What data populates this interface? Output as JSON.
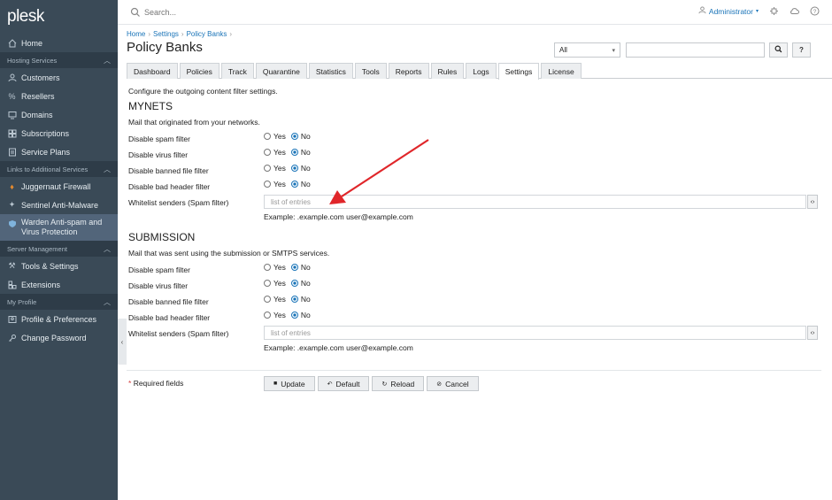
{
  "sidebar": {
    "logo": "plesk",
    "home": "Home",
    "sections": {
      "hosting": "Hosting Services",
      "links": "Links to Additional Services",
      "server": "Server Management",
      "profile": "My Profile"
    },
    "hosting_items": [
      "Customers",
      "Resellers",
      "Domains",
      "Subscriptions",
      "Service Plans"
    ],
    "link_items": [
      "Juggernaut Firewall",
      "Sentinel Anti-Malware",
      "Warden Anti-spam and Virus Protection"
    ],
    "server_items": [
      "Tools & Settings",
      "Extensions"
    ],
    "profile_items": [
      "Profile & Preferences",
      "Change Password"
    ]
  },
  "topbar": {
    "search_placeholder": "Search...",
    "user": "Administrator"
  },
  "breadcrumb": [
    "Home",
    "Settings",
    "Policy Banks"
  ],
  "page_title": "Policy Banks",
  "filter": {
    "select_value": "All"
  },
  "tabs": [
    "Dashboard",
    "Policies",
    "Track",
    "Quarantine",
    "Statistics",
    "Tools",
    "Reports",
    "Rules",
    "Logs",
    "Settings",
    "License"
  ],
  "active_tab": "Settings",
  "intro": "Configure the outgoing content filter settings.",
  "sections": [
    {
      "title": "MYNETS",
      "subtitle": "Mail that originated from your networks.",
      "rows": [
        {
          "label": "Disable spam filter",
          "value": "No"
        },
        {
          "label": "Disable virus filter",
          "value": "No"
        },
        {
          "label": "Disable banned file filter",
          "value": "No"
        },
        {
          "label": "Disable bad header filter",
          "value": "No"
        }
      ],
      "whitelist_label": "Whitelist senders (Spam filter)",
      "whitelist_placeholder": "list of entries",
      "example": "Example: .example.com user@example.com"
    },
    {
      "title": "SUBMISSION",
      "subtitle": "Mail that was sent using the submission or SMTPS services.",
      "rows": [
        {
          "label": "Disable spam filter",
          "value": "No"
        },
        {
          "label": "Disable virus filter",
          "value": "No"
        },
        {
          "label": "Disable banned file filter",
          "value": "No"
        },
        {
          "label": "Disable bad header filter",
          "value": "No"
        }
      ],
      "whitelist_label": "Whitelist senders (Spam filter)",
      "whitelist_placeholder": "list of entries",
      "example": "Example: .example.com user@example.com"
    }
  ],
  "radio_labels": {
    "yes": "Yes",
    "no": "No"
  },
  "required_text": "Required fields",
  "buttons": {
    "update": "Update",
    "default": "Default",
    "reload": "Reload",
    "cancel": "Cancel"
  },
  "colors": {
    "sidebar": "#3a4a57",
    "accent": "#1a74b8",
    "annotation_arrow": "#e0262a"
  }
}
